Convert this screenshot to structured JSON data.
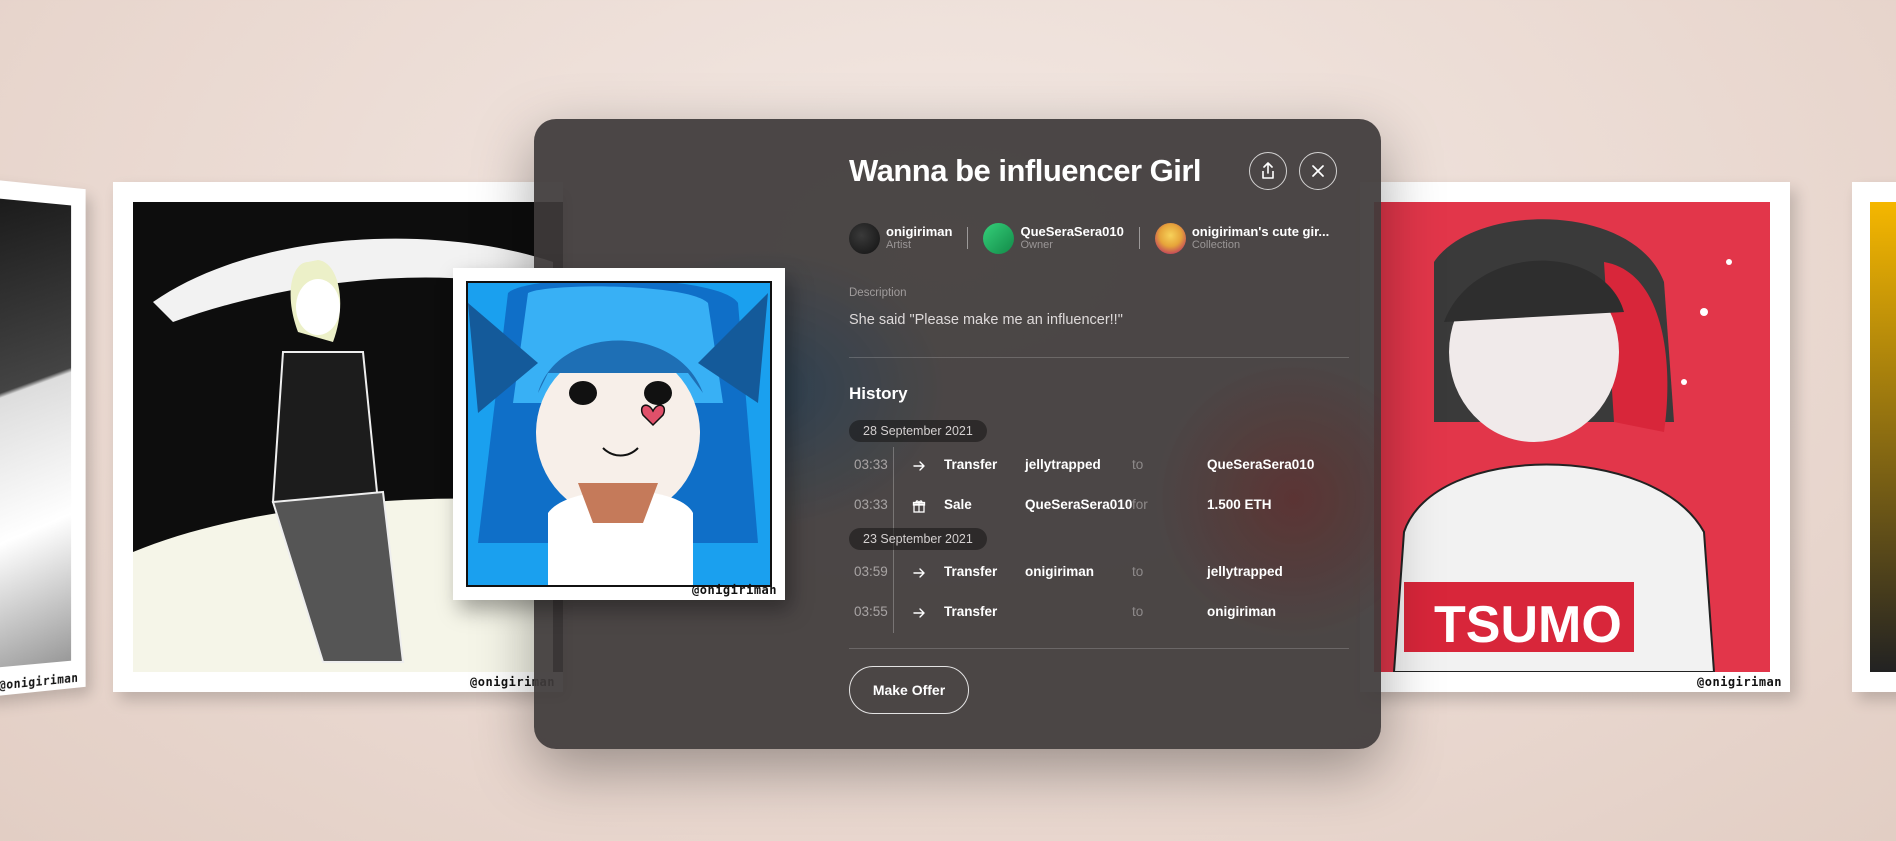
{
  "title": "Wanna be influencer Girl",
  "people": [
    {
      "name": "onigiriman",
      "role": "Artist"
    },
    {
      "name": "QueSeraSera010",
      "role": "Owner"
    },
    {
      "name": "onigiriman's cute gir...",
      "role": "Collection"
    }
  ],
  "description": {
    "label": "Description",
    "text": "She said \"Please make me an influencer!!\""
  },
  "history": {
    "title": "History",
    "groups": [
      {
        "date": "28 September 2021",
        "rows": [
          {
            "time": "03:33",
            "icon": "arrow-right-icon",
            "type": "Transfer",
            "from": "jellytrapped",
            "prep": "to",
            "to": "QueSeraSera010"
          },
          {
            "time": "03:33",
            "icon": "gift-icon",
            "type": "Sale",
            "from": "QueSeraSera010",
            "prep": "for",
            "to": "1.500 ETH"
          }
        ]
      },
      {
        "date": "23 September 2021",
        "rows": [
          {
            "time": "03:59",
            "icon": "arrow-right-icon",
            "type": "Transfer",
            "from": "onigiriman",
            "prep": "to",
            "to": "jellytrapped"
          },
          {
            "time": "03:55",
            "icon": "arrow-right-icon",
            "type": "Transfer",
            "from": "",
            "prep": "to",
            "to": "onigiriman"
          }
        ]
      }
    ]
  },
  "actions": {
    "make_offer": "Make Offer"
  },
  "artworks": {
    "signature": "@onigiriman",
    "right_text": "TSUMO"
  },
  "icons": {
    "share": "share-icon",
    "close": "close-icon"
  },
  "colors": {
    "modal_bg": "#3e3a3a",
    "page_bg": "#ead9d1",
    "accent_red": "#e2364a",
    "accent_blue": "#1aa0ef"
  }
}
